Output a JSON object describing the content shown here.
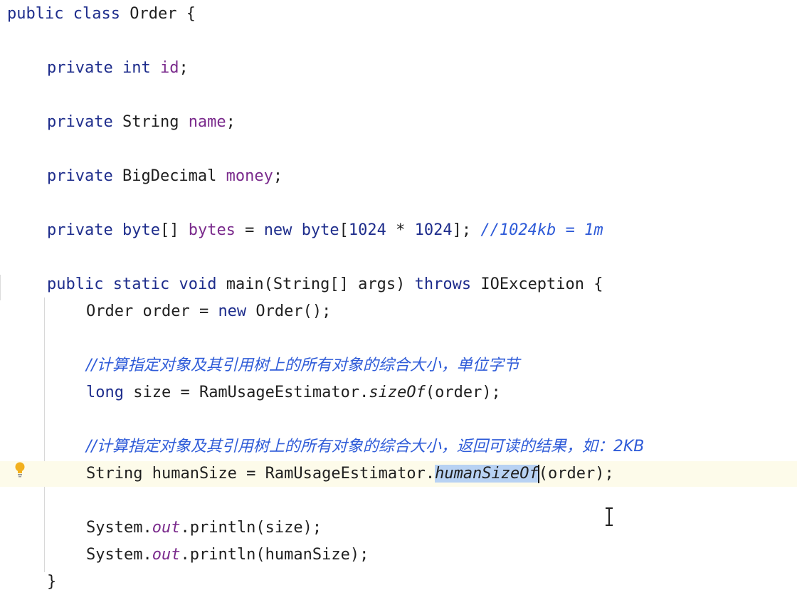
{
  "editor": {
    "lines": [
      {
        "indent": 0,
        "parts": [
          "public",
          " ",
          "class",
          " Order {"
        ]
      },
      {
        "indent": 1,
        "parts": [
          "private",
          " ",
          "int",
          " ",
          "id",
          ";"
        ]
      },
      {
        "indent": 1,
        "parts": [
          "private",
          " String ",
          "name",
          ";"
        ]
      },
      {
        "indent": 1,
        "parts": [
          "private",
          " BigDecimal ",
          "money",
          ";"
        ]
      },
      {
        "indent": 1,
        "parts": [
          "private",
          " ",
          "byte",
          "[] ",
          "bytes",
          " = ",
          "new",
          " ",
          "byte",
          "[",
          "1024",
          " * ",
          "1024",
          "]; ",
          "//1024kb = 1m"
        ]
      },
      {
        "indent": 1,
        "parts": [
          "public",
          " ",
          "static",
          " ",
          "void",
          " main(String[] args) ",
          "throws",
          " IOException {"
        ]
      },
      {
        "indent": 2,
        "parts": [
          "Order order = ",
          "new",
          " Order();"
        ]
      },
      {
        "indent": 2,
        "parts": [
          "//计算指定对象及其引用树上的所有对象的综合大小，单位字节"
        ]
      },
      {
        "indent": 2,
        "parts": [
          "long",
          " size = RamUsageEstimator.",
          "sizeOf",
          "(order);"
        ]
      },
      {
        "indent": 2,
        "parts": [
          "//计算指定对象及其引用树上的所有对象的综合大小，返回可读的结果，如：2KB"
        ]
      },
      {
        "indent": 2,
        "parts": [
          "String humanSize = RamUsageEstimator.",
          "humanSizeOf",
          "(order);"
        ]
      },
      {
        "indent": 2,
        "parts": [
          "System.",
          "out",
          ".println(size);"
        ]
      },
      {
        "indent": 2,
        "parts": [
          "System.",
          "out",
          ".println(humanSize);"
        ]
      },
      {
        "indent": 1,
        "parts": [
          "}"
        ]
      }
    ],
    "selected_token": "humanSizeOf",
    "intention_icon": "lightbulb-icon",
    "colors": {
      "keyword": "#1e2d8c",
      "field": "#7a2a8c",
      "comment": "#2e5bd8",
      "selection": "#b8d2f3",
      "caret_line": "#fdfbea"
    }
  }
}
